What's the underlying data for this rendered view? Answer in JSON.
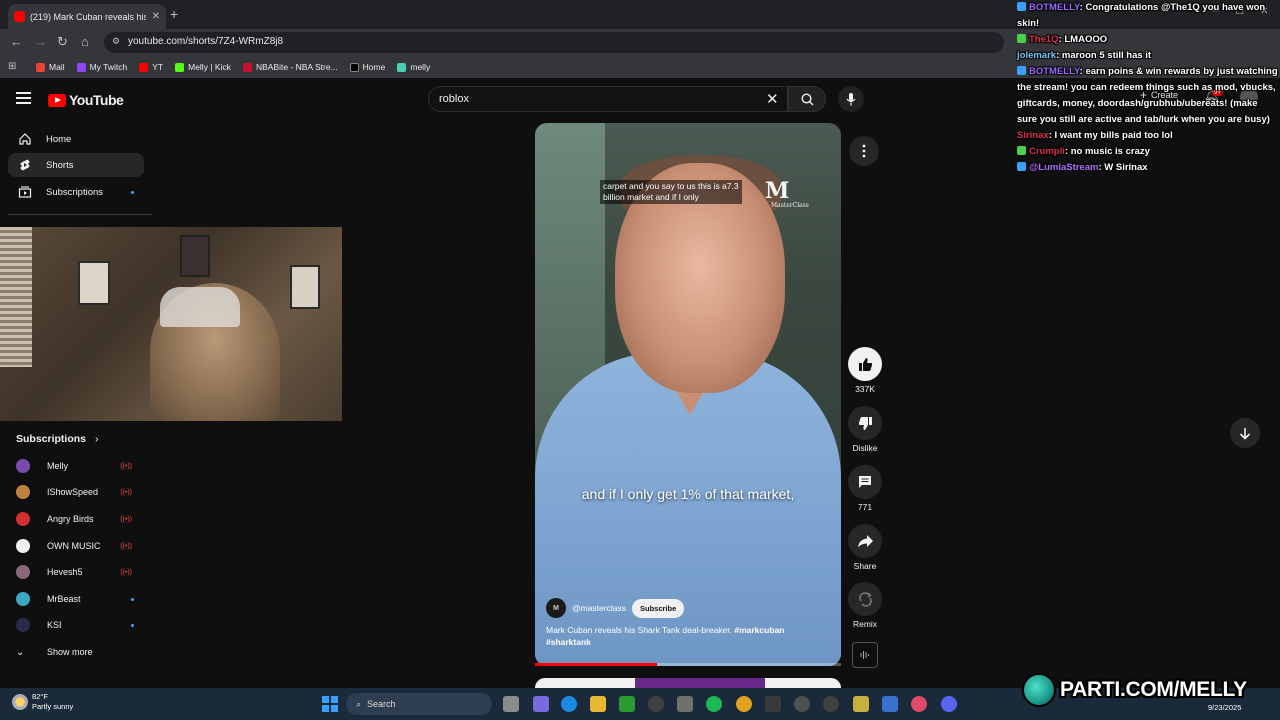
{
  "browser": {
    "tab_title": "(219) Mark Cuban reveals his Shark Tank deal-breaker",
    "url": "youtube.com/shorts/7Z4-WRmZ8j8",
    "bookmarks": [
      "Mail",
      "My Twitch",
      "YT",
      "Melly | Kick",
      "NBABite - NBA Stre...",
      "Home",
      "melly"
    ]
  },
  "youtube": {
    "logo": "YouTube",
    "search_value": "roblox",
    "nav": [
      {
        "label": "Home"
      },
      {
        "label": "Shorts"
      },
      {
        "label": "Subscriptions"
      }
    ],
    "subscriptions_heading": "Subscriptions",
    "subscriptions": [
      {
        "name": "Melly",
        "status": "live",
        "color": "#7a4ab0"
      },
      {
        "name": "IShowSpeed",
        "status": "live",
        "color": "#c08040"
      },
      {
        "name": "Angry Birds",
        "status": "live",
        "color": "#d03030"
      },
      {
        "name": "OWN MUSIC",
        "status": "live",
        "color": "#f0f0f0"
      },
      {
        "name": "Hevesh5",
        "status": "live",
        "color": "#8a6a7a"
      },
      {
        "name": "MrBeast",
        "status": "new",
        "color": "#3aa8c0"
      },
      {
        "name": "KSI",
        "status": "new",
        "color": "#2a2a4a"
      }
    ],
    "show_more": "Show more",
    "create_label": "Create",
    "notification_count": "9+"
  },
  "short": {
    "top_caption": "carpet and you say to us this is a7.3 billion market and if I only",
    "caption": "and if I only get 1% of that market,",
    "watermark": "M",
    "watermark_sub": "MasterClass",
    "channel_handle": "@masterclass",
    "channel_avatar": "M",
    "subscribe_label": "Subscribe",
    "title_text": "Mark Cuban reveals his Shark Tank deal-breaker. ",
    "hashtag1": "#markcuban",
    "hashtag2": "#sharktank",
    "progress": 0.4,
    "likes": "337K",
    "dislike_label": "Dislike",
    "comments": "771",
    "share_label": "Share",
    "remix_label": "Remix"
  },
  "chat": [
    {
      "user": "BOTMELLY",
      "text": ": Congratulations @The1Q you have won skin!",
      "color": "#9b6bff",
      "badge": "#3aa0ff"
    },
    {
      "user": "The1Q",
      "text": ": LMAOOO",
      "color": "#e0304a",
      "badge": "#4ad04a"
    },
    {
      "user": "jolemark",
      "text": ": maroon 5 still has it",
      "color": "#7ac8ff",
      "badge": ""
    },
    {
      "user": "BOTMELLY",
      "text": ": earn poins & win rewards by just watching the stream! you can redeem things such as mod, vbucks, giftcards, money, doordash/grubhub/ubereats! (make sure you still are active and tab/lurk when you are busy)",
      "color": "#9b6bff",
      "badge": "#3aa0ff"
    },
    {
      "user": "Sirinax",
      "text": ": I want my bills paid too lol",
      "color": "#e0304a",
      "badge": ""
    },
    {
      "user": "Crumpli",
      "text": ": no music is crazy",
      "color": "#e0304a",
      "badge": "#4ad04a"
    },
    {
      "user": "@LumiaStream",
      "text": ": W Sirinax",
      "color": "#b070ff",
      "badge": "#3aa0ff"
    }
  ],
  "taskbar": {
    "temperature": "82°F",
    "weather": "Partly sunny",
    "search_label": "Search",
    "date": "9/23/2025"
  },
  "overlay": {
    "brand": "PARTI.COM/MELLY"
  }
}
